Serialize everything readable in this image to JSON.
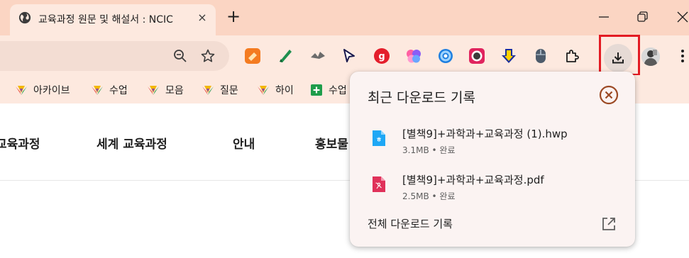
{
  "tab": {
    "title": "교육과정 원문 및 해설서 : NCIC",
    "favicon": "globe-icon",
    "close": "×",
    "new_tab": "+"
  },
  "window": {
    "controls": [
      "minimize-icon",
      "restore-icon",
      "close-icon"
    ]
  },
  "omnibox": {
    "icons": [
      "zoom-out-icon",
      "star-icon"
    ]
  },
  "extensions": [
    "eraser-ext-icon",
    "pen-ext-icon",
    "bird-ext-icon",
    "cursor-ext-icon",
    "g-ext-icon",
    "brain-ext-icon",
    "swirl-ext-icon",
    "record-ext-icon",
    "download-arrow-ext-icon",
    "mouse-ext-icon",
    "puzzle-icon"
  ],
  "toolbar": {
    "download_icon": "download-icon",
    "avatar": "profile-avatar",
    "menu": "more-vertical-icon"
  },
  "bookmarks": [
    {
      "label": "아카이브",
      "icon": "crane-icon"
    },
    {
      "label": "수업",
      "icon": "crane-icon"
    },
    {
      "label": "모음",
      "icon": "crane-icon"
    },
    {
      "label": "질문",
      "icon": "crane-icon"
    },
    {
      "label": "하이",
      "icon": "crane-icon"
    },
    {
      "label": "수업",
      "icon": "plus-square-icon"
    }
  ],
  "page_nav": [
    {
      "label": "교육과정"
    },
    {
      "label": "세계 교육과정"
    },
    {
      "label": "안내"
    },
    {
      "label": "홍보물"
    }
  ],
  "downloads": {
    "title": "최근 다운로드 기록",
    "items": [
      {
        "name": "[별책9]+과학과+교육과정 (1).hwp",
        "size": "3.1MB",
        "status": "완료",
        "separator": "•",
        "type": "hwp"
      },
      {
        "name": "[별책9]+과학과+교육과정.pdf",
        "size": "2.5MB",
        "status": "완료",
        "separator": "•",
        "type": "pdf"
      }
    ],
    "footer": "전체 다운로드 기록"
  },
  "colors": {
    "tabstrip": "#fbd5c3",
    "toolbar": "#fde9df",
    "highlight": "#e31b23",
    "panel_close": "#9c4a25"
  }
}
